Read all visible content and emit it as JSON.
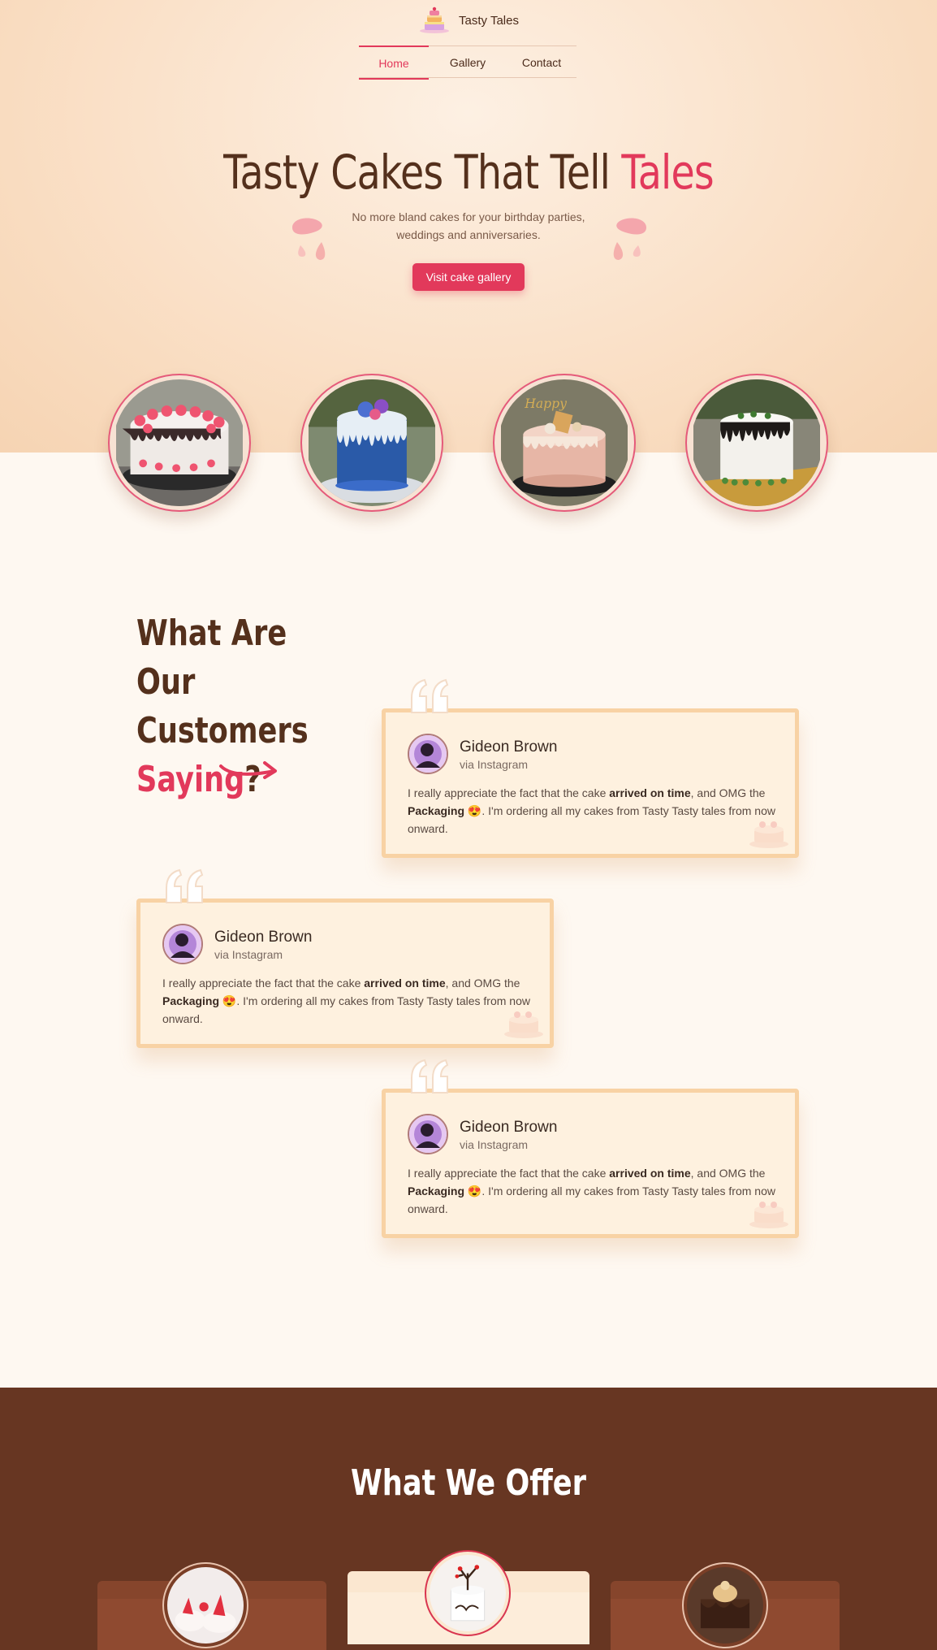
{
  "brand": {
    "name": "Tasty Tales",
    "logo_icon": "cake-logo-icon"
  },
  "nav": {
    "items": [
      "Home",
      "Gallery",
      "Contact"
    ],
    "active": "Home"
  },
  "hero": {
    "title_main": "Tasty Cakes That Tell ",
    "title_accent": "Tales",
    "subtitle": "No more bland cakes for your birthday parties, weddings and anniversaries.",
    "cta_label": "Visit cake gallery"
  },
  "gallery": {
    "images": [
      "red-white-drip-cake-image",
      "blue-drip-cake-image",
      "pink-birthday-cake-image",
      "white-drip-green-cake-image"
    ]
  },
  "testimonials": {
    "title_line1": "What Are Our",
    "title_line2": "Customers",
    "title_accent": "Saying",
    "title_end": "?",
    "items": [
      {
        "name": "Gideon Brown",
        "via": "via Instagram",
        "text_1": "I really appreciate the fact that the cake ",
        "bold_1": "arrived on time",
        "text_2": ", and OMG the ",
        "bold_2": "Packaging",
        "text_3": " 😍. I'm ordering all my cakes from Tasty Tasty tales from now onward."
      },
      {
        "name": "Gideon Brown",
        "via": "via Instagram",
        "text_1": "I really appreciate the fact that the cake ",
        "bold_1": "arrived on time",
        "text_2": ", and OMG the ",
        "bold_2": "Packaging",
        "text_3": " 😍. I'm ordering all my cakes from Tasty Tasty tales from now onward."
      },
      {
        "name": "Gideon Brown",
        "via": "via Instagram",
        "text_1": "I really appreciate the fact that the cake ",
        "bold_1": "arrived on time",
        "text_2": ", and OMG the ",
        "bold_2": "Packaging",
        "text_3": " 😍. I'm ordering all my cakes from Tasty Tasty tales from now onward."
      }
    ]
  },
  "offer": {
    "title": "What We Offer"
  },
  "colors": {
    "accent": "#e2395b",
    "brown": "#54301c",
    "offer_bg": "#673622",
    "card_border": "#f8d2a4"
  }
}
